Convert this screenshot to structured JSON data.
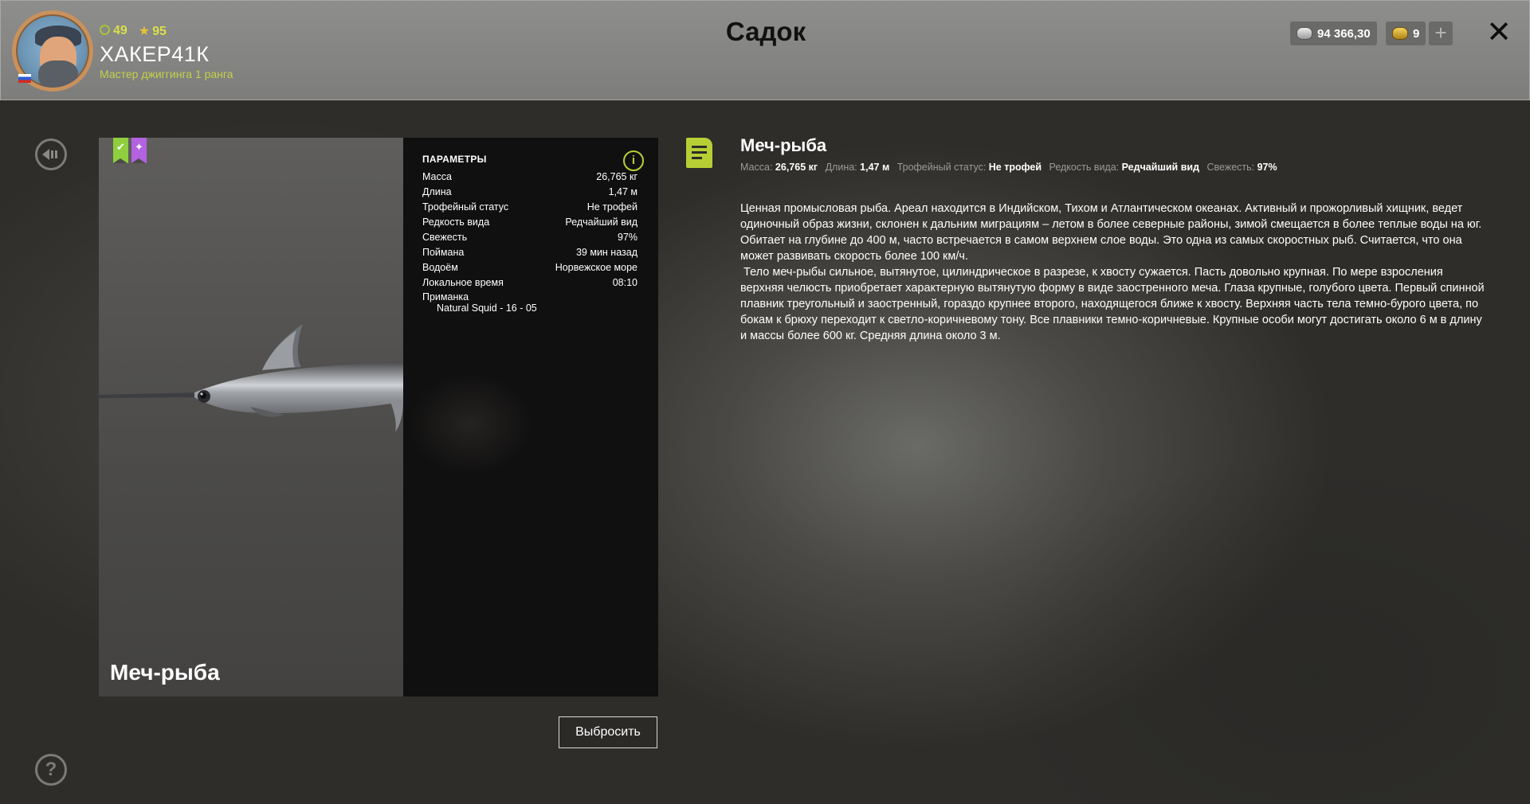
{
  "header": {
    "stat_xp": "49",
    "stat_stars": "95",
    "username": "ХАКЕР41К",
    "rank": "Мастер джиггинга 1 ранга",
    "title": "Садок",
    "silver": "94 366,30",
    "gold": "9",
    "plus": "+",
    "close": "✕"
  },
  "fish": {
    "name": "Меч-рыба",
    "params_title": "ПАРАМЕТРЫ",
    "params": [
      {
        "label": "Масса",
        "value": "26,765 кг"
      },
      {
        "label": "Длина",
        "value": "1,47 м"
      },
      {
        "label": "Трофейный статус",
        "value": "Не трофей"
      },
      {
        "label": "Редкость вида",
        "value": "Редчайший вид"
      },
      {
        "label": "Свежесть",
        "value": "97%"
      },
      {
        "label": "Поймана",
        "value": "39 мин назад"
      },
      {
        "label": "Водоём",
        "value": "Норвежское море"
      },
      {
        "label": "Локальное время",
        "value": "08:10"
      }
    ],
    "bait_label": "Приманка",
    "bait_value": "Natural Squid - 16 - 05",
    "info": "i"
  },
  "actions": {
    "discard": "Выбросить",
    "help": "?"
  },
  "description": {
    "title": "Меч-рыба",
    "meta": [
      {
        "label": "Масса:",
        "value": "26,765 кг"
      },
      {
        "label": "Длина:",
        "value": "1,47 м"
      },
      {
        "label": "Трофейный статус:",
        "value": "Не трофей"
      },
      {
        "label": "Редкость вида:",
        "value": "Редчайший вид"
      },
      {
        "label": "Свежесть:",
        "value": "97%"
      }
    ],
    "paragraph1": "Ценная промысловая рыба. Ареал находится в Индийском, Тихом и Атлантическом океанах. Активный и прожорливый хищник, ведет одиночный образ жизни, склонен к дальним миграциям – летом в более северные районы, зимой смещается в более теплые воды на юг. Обитает на глубине до 400 м, часто встречается в самом верхнем слое воды. Это одна из самых скоростных рыб. Считается, что она может развивать скорость более 100 км/ч.",
    "paragraph2": " Тело меч-рыбы сильное, вытянутое, цилиндрическое в разрезе, к хвосту сужается. Пасть довольно крупная. По мере взросления верхняя челюсть приобретает характерную вытянутую форму в виде заостренного меча. Глаза крупные, голубого цвета. Первый спинной плавник треугольный и заостренный, гораздо крупнее второго, находящегося ближе к хвосту. Верхняя часть тела темно-бурого цвета, по бокам к брюху переходит к светло-коричневому тону. Все плавники темно-коричневые. Крупные особи могут достигать около 6 м в длину и массы более 600 кг. Средняя длина около 3 м."
  },
  "colors": {
    "accent": "#b7cf35",
    "badge_green": "#8fcf3d",
    "badge_purple": "#b362e0"
  }
}
